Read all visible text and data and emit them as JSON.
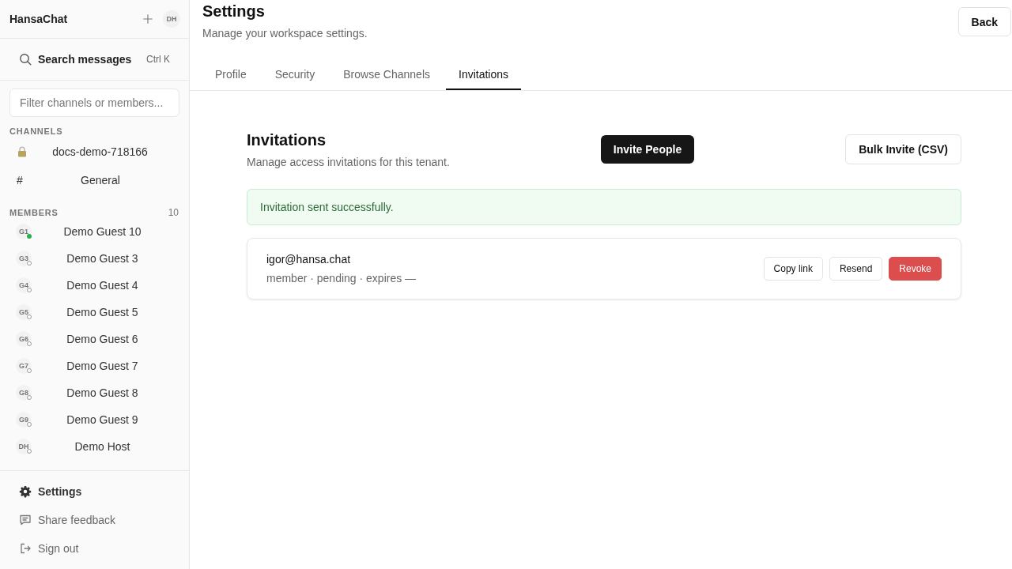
{
  "sidebar": {
    "workspace": "HansaChat",
    "user_avatar": "DH",
    "search": {
      "label": "Search messages",
      "shortcut": "Ctrl K"
    },
    "filter": {
      "placeholder": "Filter channels or members..."
    },
    "channels": {
      "heading": "CHANNELS",
      "items": [
        {
          "kind": "private",
          "name": "docs-demo-718166"
        },
        {
          "kind": "public",
          "prefix": "#",
          "name": "General"
        }
      ]
    },
    "members": {
      "heading": "MEMBERS",
      "count": "10",
      "items": [
        {
          "initials": "G1",
          "name": "Demo Guest 10",
          "online": true
        },
        {
          "initials": "G3",
          "name": "Demo Guest 3",
          "online": false
        },
        {
          "initials": "G4",
          "name": "Demo Guest 4",
          "online": false
        },
        {
          "initials": "G5",
          "name": "Demo Guest 5",
          "online": false
        },
        {
          "initials": "G6",
          "name": "Demo Guest 6",
          "online": false
        },
        {
          "initials": "G7",
          "name": "Demo Guest 7",
          "online": false
        },
        {
          "initials": "G8",
          "name": "Demo Guest 8",
          "online": false
        },
        {
          "initials": "G9",
          "name": "Demo Guest 9",
          "online": false
        },
        {
          "initials": "DH",
          "name": "Demo Host",
          "online": false
        }
      ]
    },
    "footer_items": [
      {
        "kind": "settings",
        "label": "Settings",
        "selected": true
      },
      {
        "kind": "feedback",
        "label": "Share feedback",
        "selected": false
      },
      {
        "kind": "sign_out",
        "label": "Sign out",
        "selected": false
      }
    ]
  },
  "header": {
    "title": "Settings",
    "subtitle": "Manage your workspace settings.",
    "back_button": "Back"
  },
  "tabs": [
    {
      "label": "Profile",
      "selected": false
    },
    {
      "label": "Security",
      "selected": false
    },
    {
      "label": "Browse Channels",
      "selected": false
    },
    {
      "label": "Invitations",
      "selected": true
    }
  ],
  "invitations": {
    "title": "Invitations",
    "subtitle": "Manage access invitations for this tenant.",
    "invite_button": "Invite People",
    "bulk_button": "Bulk Invite (CSV)",
    "alert": {
      "kind": "success",
      "text": "Invitation sent successfully."
    },
    "items": [
      {
        "email": "igor@hansa.chat",
        "details": "member · pending · expires —",
        "actions": [
          {
            "kind": "secondary",
            "label": "Copy link"
          },
          {
            "kind": "secondary",
            "label": "Resend"
          },
          {
            "kind": "danger",
            "label": "Revoke"
          }
        ]
      }
    ]
  }
}
